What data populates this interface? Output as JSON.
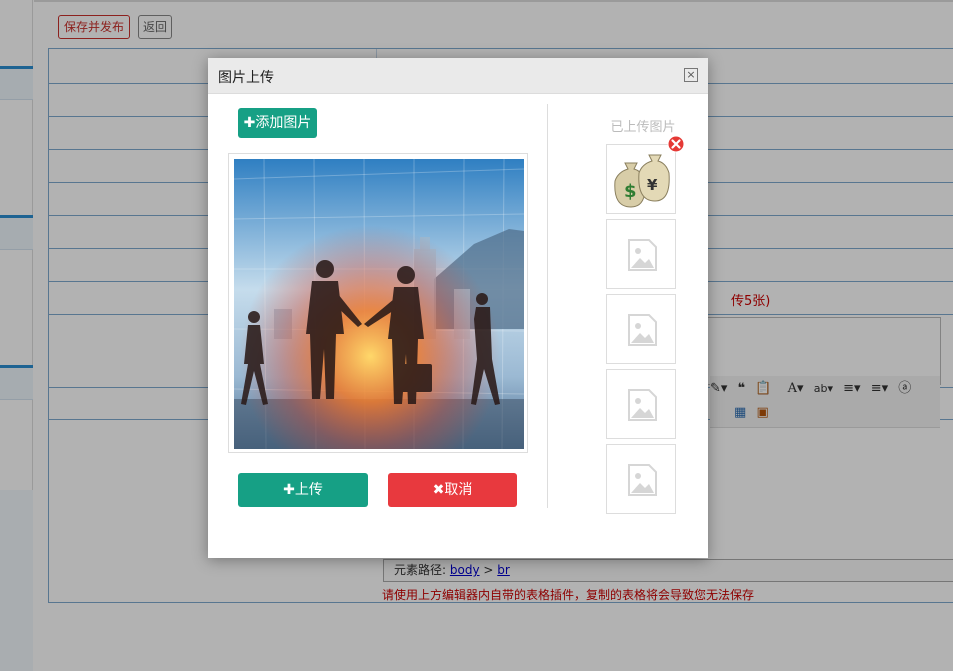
{
  "toolbar": {
    "publish_label": "保存并发布",
    "back_label": "返回"
  },
  "form": {
    "note_suffix": "传5张)",
    "path_label": "元素路径:",
    "path_body": "body",
    "path_sep": ">",
    "path_br": "br",
    "warning": "请使用上方编辑器内自带的表格插件，复制的表格将会导致您无法保存"
  },
  "modal": {
    "title": "图片上传",
    "close_glyph": "×",
    "add_label": "添加图片",
    "upload_label": "上传",
    "cancel_label": "取消",
    "uploaded_title": "已上传图片"
  },
  "icons": {
    "plus": "plus-icon",
    "close": "close-icon",
    "delete": "delete-circle-icon",
    "placeholder": "image-placeholder-icon"
  },
  "colors": {
    "green": "#16a085",
    "red": "#e8393e",
    "accent_blue": "#2b8fd1"
  }
}
